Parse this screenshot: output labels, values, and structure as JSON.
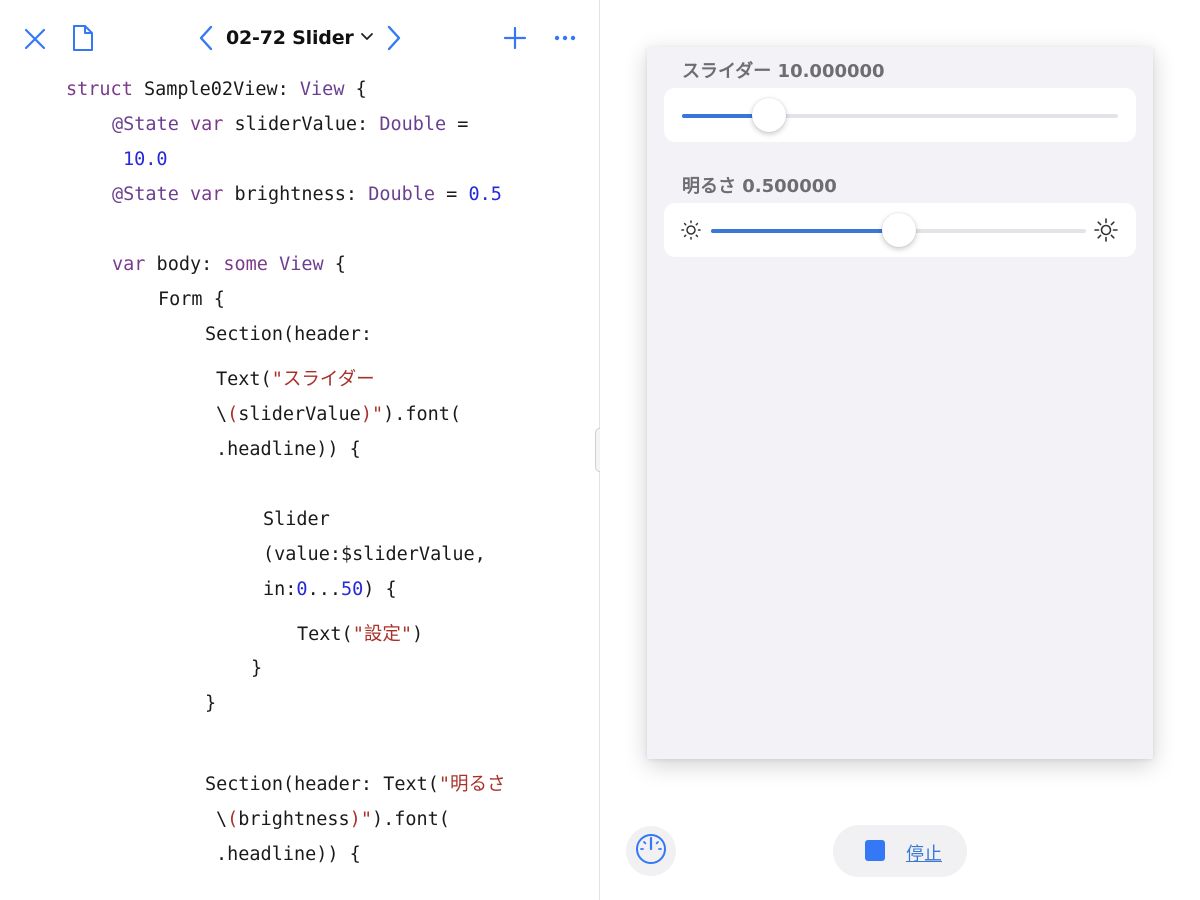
{
  "toolbar": {
    "title": "02-72 Slider",
    "icons": {
      "close": "close-icon",
      "document": "document-icon",
      "back": "chevron-left-icon",
      "title_menu": "chevron-down-icon",
      "forward": "chevron-right-icon",
      "add": "plus-icon",
      "more": "ellipsis-icon"
    },
    "accent_color": "#3478f6"
  },
  "code": {
    "l1": {
      "a": "struct",
      "b": " Sample02View: ",
      "c": "View",
      "d": " {"
    },
    "l2": {
      "a": "@State",
      "b": " ",
      "c": "var",
      "d": " sliderValue: ",
      "e": "Double",
      "f": " ="
    },
    "l3": {
      "a": "10.0"
    },
    "l4": {
      "a": "@State",
      "b": " ",
      "c": "var",
      "d": " brightness: ",
      "e": "Double",
      "f": " = ",
      "g": "0.5"
    },
    "l5": {
      "a": "var",
      "b": " body: ",
      "c": "some",
      "d": " ",
      "e": "View",
      "f": " {"
    },
    "l6": {
      "a": "Form {"
    },
    "l7": {
      "a": "Section(header:"
    },
    "l8": {
      "a": "Text(",
      "b": "\"スライダー"
    },
    "l9": {
      "a": "\\",
      "b": "(",
      "c": "sliderValue",
      "d": ")",
      "e": "\"",
      "f": ").font("
    },
    "l10": {
      "a": ".headline)) {"
    },
    "l11": {
      "a": "Slider"
    },
    "l12": {
      "a": "(value:$sliderValue,"
    },
    "l13": {
      "a": "in:",
      "b": "0",
      "c": "...",
      "d": "50",
      "e": ") {"
    },
    "l14": {
      "a": "Text(",
      "b": "\"設定\"",
      "c": ")"
    },
    "l15": {
      "a": "}"
    },
    "l16": {
      "a": "}"
    },
    "l17": {
      "a": "Section(header: Text(",
      "b": "\"明るさ"
    },
    "l18": {
      "a": "\\",
      "b": "(",
      "c": "brightness",
      "d": ")",
      "e": "\"",
      "f": ").font("
    },
    "l19": {
      "a": ".headline)) {"
    }
  },
  "preview": {
    "slider_section": {
      "header": "スライダー 10.000000",
      "value": 10.0,
      "min": 0,
      "max": 50
    },
    "brightness_section": {
      "header": "明るさ 0.500000",
      "value": 0.5,
      "min": 0,
      "max": 1,
      "min_icon": "sun-min-icon",
      "max_icon": "sun-max-icon"
    },
    "tint_color": "#3a76d8",
    "gauge_icon": "gauge-icon",
    "stop_label": "停止",
    "stop_icon": "stop-square-icon"
  }
}
